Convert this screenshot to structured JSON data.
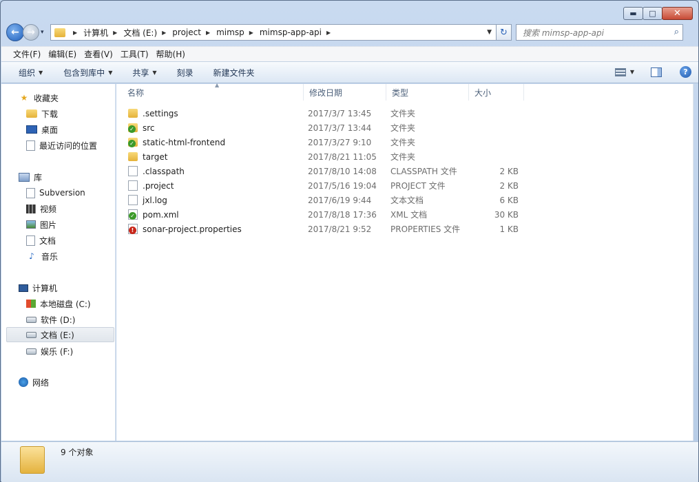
{
  "window": {
    "minimize_glyph": "▬",
    "maximize_glyph": "□",
    "close_glyph": "✕"
  },
  "nav": {
    "back_glyph": "←",
    "forward_glyph": "→",
    "history_glyph": "▾",
    "breadcrumb": [
      "计算机",
      "文档 (E:)",
      "project",
      "mimsp",
      "mimsp-app-api"
    ],
    "crumb_separator": "▶",
    "address_dropdown_glyph": "▼",
    "refresh_glyph": "↻"
  },
  "search": {
    "placeholder": "搜索 mimsp-app-api",
    "icon": "search-icon",
    "glyph": "⌕"
  },
  "menubar": [
    "文件(F)",
    "编辑(E)",
    "查看(V)",
    "工具(T)",
    "帮助(H)"
  ],
  "toolbar": {
    "organize": "组织",
    "include_in_library": "包含到库中",
    "share": "共享",
    "burn": "刻录",
    "new_folder": "新建文件夹",
    "dropdown_glyph": "▼",
    "help_glyph": "?"
  },
  "sidebar": {
    "favorites": {
      "label": "收藏夹",
      "items": [
        "下载",
        "桌面",
        "最近访问的位置"
      ]
    },
    "libraries": {
      "label": "库",
      "items": [
        "Subversion",
        "视频",
        "图片",
        "文档",
        "音乐"
      ]
    },
    "computer": {
      "label": "计算机",
      "items": [
        "本地磁盘 (C:)",
        "软件 (D:)",
        "文档 (E:)",
        "娱乐 (F:)"
      ],
      "selected": "文档 (E:)"
    },
    "network": {
      "label": "网络"
    }
  },
  "columns": {
    "name": "名称",
    "date": "修改日期",
    "type": "类型",
    "size": "大小",
    "sort_glyph": "▲"
  },
  "files": [
    {
      "name": ".settings",
      "date": "2017/3/7 13:45",
      "type": "文件夹",
      "size": "",
      "icon": "folder",
      "badge": ""
    },
    {
      "name": "src",
      "date": "2017/3/7 13:44",
      "type": "文件夹",
      "size": "",
      "icon": "folder",
      "badge": "ok"
    },
    {
      "name": "static-html-frontend",
      "date": "2017/3/27 9:10",
      "type": "文件夹",
      "size": "",
      "icon": "folder",
      "badge": "ok"
    },
    {
      "name": "target",
      "date": "2017/8/21 11:05",
      "type": "文件夹",
      "size": "",
      "icon": "folder",
      "badge": ""
    },
    {
      "name": ".classpath",
      "date": "2017/8/10 14:08",
      "type": "CLASSPATH 文件",
      "size": "2 KB",
      "icon": "file",
      "badge": ""
    },
    {
      "name": ".project",
      "date": "2017/5/16 19:04",
      "type": "PROJECT 文件",
      "size": "2 KB",
      "icon": "file",
      "badge": ""
    },
    {
      "name": "jxl.log",
      "date": "2017/6/19 9:44",
      "type": "文本文档",
      "size": "6 KB",
      "icon": "file",
      "badge": ""
    },
    {
      "name": "pom.xml",
      "date": "2017/8/18 17:36",
      "type": "XML 文档",
      "size": "30 KB",
      "icon": "file",
      "badge": "ok"
    },
    {
      "name": "sonar-project.properties",
      "date": "2017/8/21 9:52",
      "type": "PROPERTIES 文件",
      "size": "1 KB",
      "icon": "file",
      "badge": "err"
    }
  ],
  "badges": {
    "ok": "✓",
    "err": "!"
  },
  "status": {
    "count_text": "9 个对象"
  }
}
